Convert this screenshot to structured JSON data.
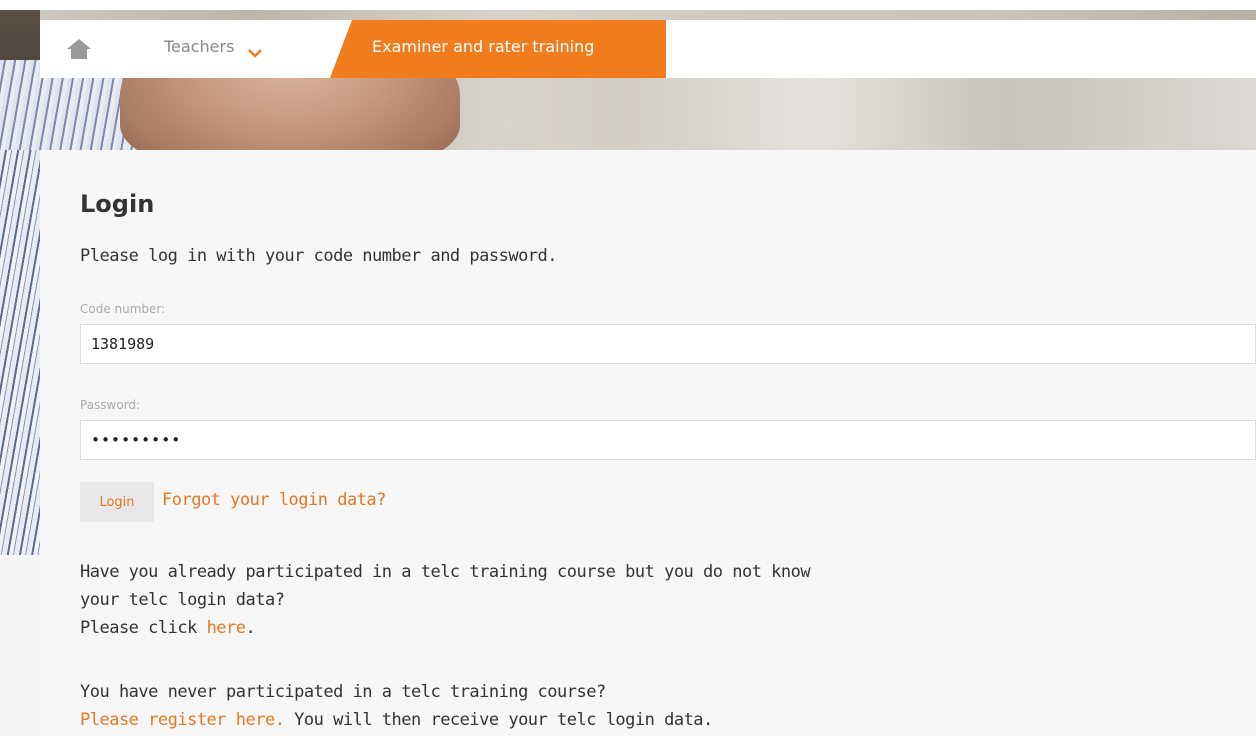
{
  "nav": {
    "home_icon": "home-icon",
    "teachers_label": "Teachers",
    "teachers_chevron": "chevron-down-icon",
    "active_tab_label": "Examiner and rater training",
    "accent_color": "#f07c1e"
  },
  "login": {
    "title": "Login",
    "intro": "Please log in with your code number and password.",
    "code_label": "Code number:",
    "code_value": "1381989",
    "password_label": "Password:",
    "password_value": "•••••••••",
    "login_button": "Login",
    "forgot_link": "Forgot your login data?"
  },
  "participated": {
    "line1": "Have you already participated in a telc training course but you do not know",
    "line2": "your telc login data?",
    "line3_prefix": "Please click ",
    "line3_link": "here",
    "line3_suffix": "."
  },
  "register": {
    "line1": "You have never participated in a telc training course?",
    "link": "Please register here.",
    "suffix": " You will then receive your telc login data."
  },
  "colors": {
    "link": "#e87722",
    "text": "#333333",
    "label": "#aaaaaa"
  }
}
